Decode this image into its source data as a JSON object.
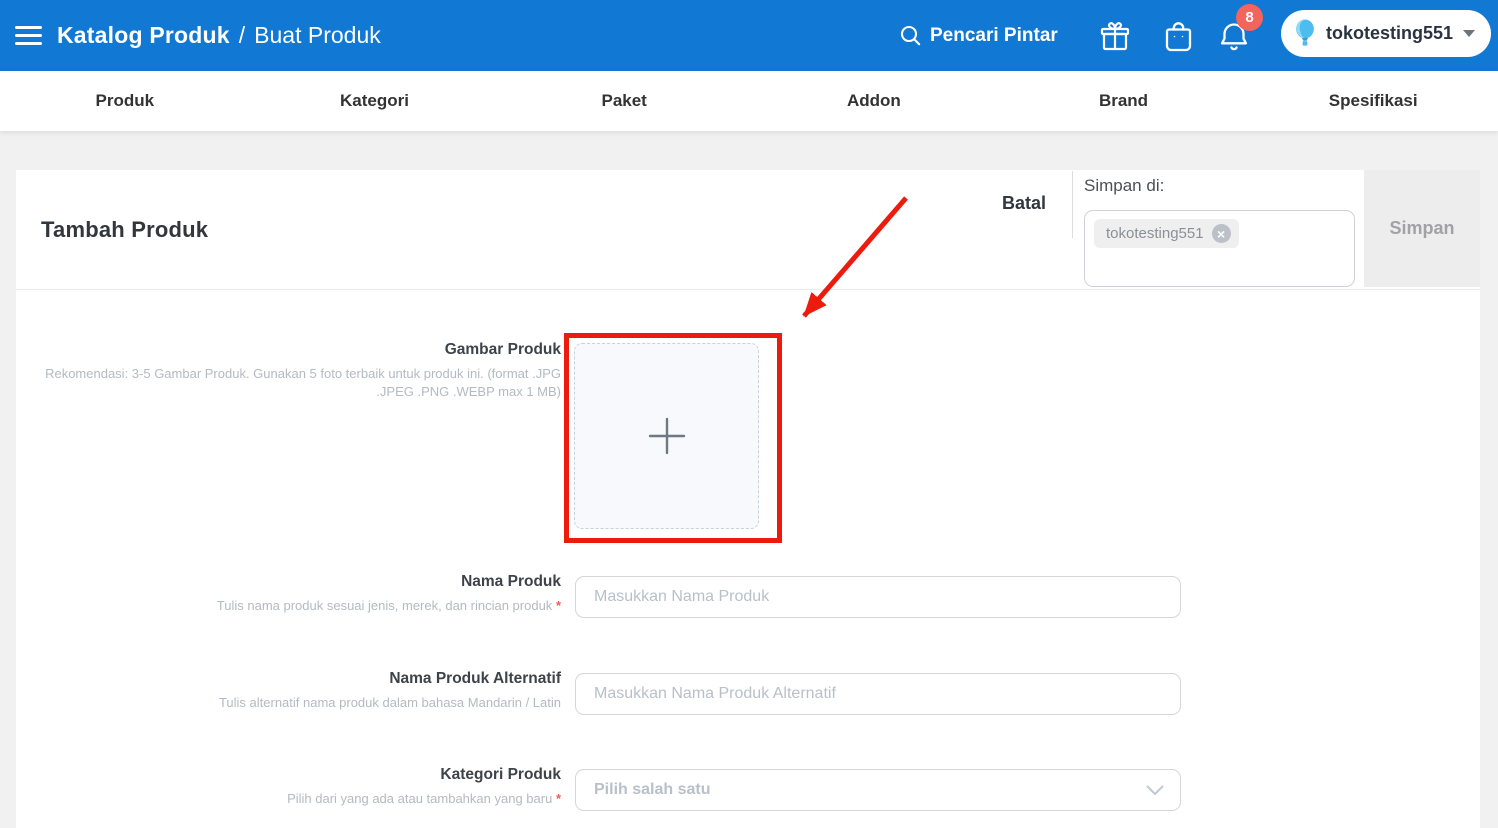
{
  "colors": {
    "header_blue": "#1178d4",
    "badge_red": "#f1655c",
    "annotation_red": "#ec1b0e",
    "required_red": "#f05c5c"
  },
  "header": {
    "breadcrumb": {
      "primary": "Katalog Produk",
      "separator": "/",
      "secondary": "Buat Produk"
    },
    "search_label": "Pencari Pintar",
    "notifications_badge": "8",
    "account_name": "tokotesting551"
  },
  "nav": {
    "tabs": [
      "Produk",
      "Kategori",
      "Paket",
      "Addon",
      "Brand",
      "Spesifikasi"
    ]
  },
  "toolbar": {
    "page_title": "Tambah Produk",
    "cancel_label": "Batal",
    "save_in_label": "Simpan di:",
    "store_tag": "tokotesting551",
    "save_label": "Simpan"
  },
  "form": {
    "image_field": {
      "label": "Gambar Produk",
      "hint": "Rekomendasi: 3-5 Gambar Produk. Gunakan 5 foto terbaik untuk produk ini. (format .JPG .JPEG .PNG .WEBP max 1 MB)"
    },
    "fields": [
      {
        "label": "Nama Produk",
        "hint": "Tulis nama produk sesuai jenis, merek, dan rincian produk",
        "required_marker": "*",
        "placeholder": "Masukkan Nama Produk"
      },
      {
        "label": "Nama Produk Alternatif",
        "hint": "Tulis alternatif nama produk dalam bahasa Mandarin / Latin",
        "placeholder": "Masukkan Nama Produk Alternatif"
      },
      {
        "label": "Kategori Produk",
        "hint": "Pilih dari yang ada atau tambahkan yang baru",
        "required_marker": "*",
        "placeholder": "Pilih salah satu"
      }
    ]
  },
  "icons": [
    "menu-icon",
    "search-icon",
    "gift-icon",
    "shopping-bag-icon",
    "bell-icon",
    "balloon-icon",
    "caret-down-icon",
    "remove-tag-icon",
    "plus-icon",
    "chevron-down-icon",
    "annotation-arrow"
  ]
}
